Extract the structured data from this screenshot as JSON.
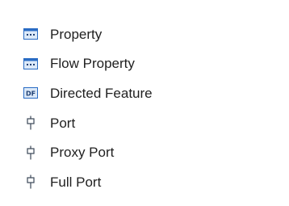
{
  "toolbox": {
    "items": [
      {
        "label": "Property",
        "icon": "property-icon"
      },
      {
        "label": "Flow Property",
        "icon": "flow-property-icon"
      },
      {
        "label": "Directed Feature",
        "icon": "directed-feature-icon",
        "icon_text": "DF"
      },
      {
        "label": "Port",
        "icon": "port-icon"
      },
      {
        "label": "Proxy Port",
        "icon": "proxy-port-icon"
      },
      {
        "label": "Full Port",
        "icon": "full-port-icon"
      }
    ]
  },
  "colors": {
    "icon_blue": "#2a6cc4",
    "icon_fill": "#dce9f8",
    "icon_dark": "#1e3f73",
    "port_stroke": "#3a4656",
    "text": "#1f1f1f"
  }
}
